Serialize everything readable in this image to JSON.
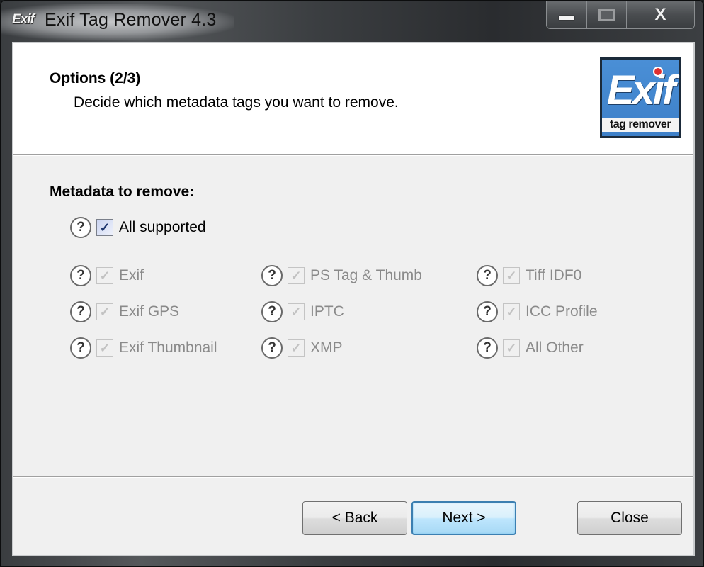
{
  "window": {
    "title": "Exif Tag Remover 4.3",
    "app_icon_text": "Exif",
    "caption": {
      "minimize": "minimize",
      "maximize": "maximize",
      "close": "X"
    }
  },
  "header": {
    "title": "Options (2/3)",
    "subtitle": "Decide which metadata tags you want to remove.",
    "logo": {
      "main": "Exif",
      "sub": "tag remover"
    }
  },
  "metadata": {
    "section_label": "Metadata to remove:",
    "all_supported": {
      "label": "All supported",
      "checked": true,
      "enabled": true
    },
    "options": [
      {
        "label": "Exif",
        "checked": true,
        "enabled": false
      },
      {
        "label": "Exif GPS",
        "checked": true,
        "enabled": false
      },
      {
        "label": "Exif Thumbnail",
        "checked": true,
        "enabled": false
      },
      {
        "label": "PS Tag & Thumb",
        "checked": true,
        "enabled": false
      },
      {
        "label": "IPTC",
        "checked": true,
        "enabled": false
      },
      {
        "label": "XMP",
        "checked": true,
        "enabled": false
      },
      {
        "label": "Tiff IDF0",
        "checked": true,
        "enabled": false
      },
      {
        "label": "ICC Profile",
        "checked": true,
        "enabled": false
      },
      {
        "label": "All Other",
        "checked": true,
        "enabled": false
      }
    ],
    "help_glyph": "?",
    "check_glyph": "✓"
  },
  "footer": {
    "back_label": "< Back",
    "next_label": "Next >",
    "close_label": "Close"
  }
}
